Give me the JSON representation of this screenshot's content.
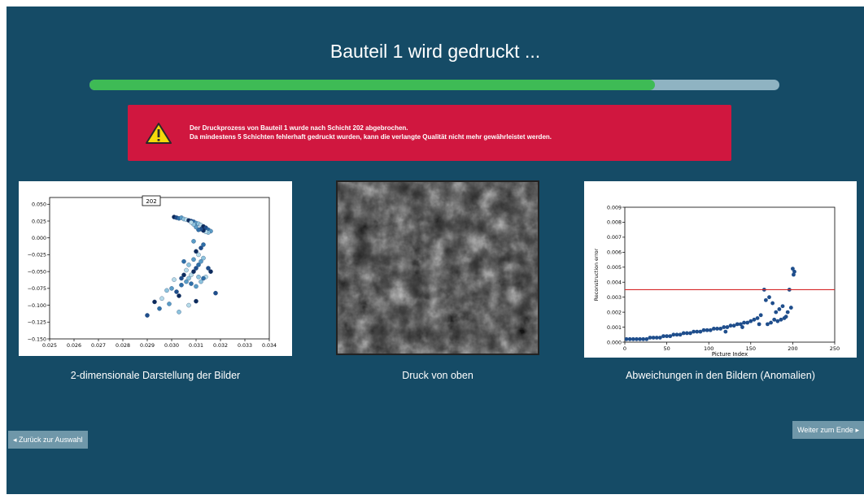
{
  "header": {
    "title": "Bauteil 1 wird gedruckt ..."
  },
  "progress": {
    "value": 0.82,
    "fill_color": "#3ebb55",
    "track_color": "#8fb3c2"
  },
  "alert": {
    "icon": "warning-icon",
    "line1": "Der Druckprozess von Bauteil 1 wurde nach Schicht 202 abgebrochen.",
    "line2": "Da mindestens 5 Schichten fehlerhaft gedruckt wurden, kann die verlangte Qualität nicht mehr gewährleistet werden.",
    "color": "#d0173f"
  },
  "panels": {
    "scatter_caption": "2-dimensionale Darstellung der Bilder",
    "photo_caption": "Druck von oben",
    "anomaly_caption": "Abweichungen in den Bildern (Anomalien)"
  },
  "nav": {
    "back_arrow": "◂",
    "back_label": "Zurück zur Auswahl",
    "next_label": "Weiter zum Ende",
    "next_arrow": "▸"
  },
  "chart_data": [
    {
      "type": "scatter",
      "annotation": "202",
      "xlim": [
        0.025,
        0.034
      ],
      "ylim": [
        -0.15,
        0.06
      ],
      "x_ticks": [
        "0.025",
        "0.026",
        "0.027",
        "0.028",
        "0.029",
        "0.030",
        "0.031",
        "0.032",
        "0.033",
        "0.034"
      ],
      "y_ticks": [
        "0.050",
        "0.025",
        "0.000",
        "−0.025",
        "−0.050",
        "−0.075",
        "−0.100",
        "−0.125",
        "−0.150"
      ],
      "points": [
        [
          0.0301,
          0.031
        ],
        [
          0.0302,
          0.03
        ],
        [
          0.0303,
          0.029
        ],
        [
          0.0304,
          0.03
        ],
        [
          0.0305,
          0.028
        ],
        [
          0.0306,
          0.027
        ],
        [
          0.0307,
          0.026
        ],
        [
          0.0308,
          0.025
        ],
        [
          0.0309,
          0.024
        ],
        [
          0.031,
          0.022
        ],
        [
          0.0311,
          0.021
        ],
        [
          0.0312,
          0.019
        ],
        [
          0.0313,
          0.017
        ],
        [
          0.0314,
          0.015
        ],
        [
          0.0315,
          0.012
        ],
        [
          0.0316,
          0.01
        ],
        [
          0.0315,
          0.008
        ],
        [
          0.0314,
          0.009
        ],
        [
          0.0313,
          0.011
        ],
        [
          0.0312,
          0.013
        ],
        [
          0.0311,
          0.012
        ],
        [
          0.031,
          0.016
        ],
        [
          0.0309,
          0.02
        ],
        [
          0.0308,
          0.023
        ],
        [
          0.0303,
          -0.086
        ],
        [
          0.0302,
          -0.08
        ],
        [
          0.0304,
          -0.07
        ],
        [
          0.0306,
          -0.065
        ],
        [
          0.0307,
          -0.06
        ],
        [
          0.0308,
          -0.055
        ],
        [
          0.0309,
          -0.05
        ],
        [
          0.031,
          -0.045
        ],
        [
          0.0311,
          -0.04
        ],
        [
          0.0312,
          -0.035
        ],
        [
          0.0313,
          -0.03
        ],
        [
          0.0311,
          -0.025
        ],
        [
          0.031,
          -0.02
        ],
        [
          0.0312,
          -0.015
        ],
        [
          0.0313,
          -0.01
        ],
        [
          0.0309,
          -0.032
        ],
        [
          0.0307,
          -0.04
        ],
        [
          0.0306,
          -0.048
        ],
        [
          0.0305,
          -0.055
        ],
        [
          0.0304,
          -0.06
        ],
        [
          0.0308,
          -0.068
        ],
        [
          0.031,
          -0.072
        ],
        [
          0.0312,
          -0.065
        ],
        [
          0.0314,
          -0.058
        ],
        [
          0.0316,
          -0.05
        ],
        [
          0.0315,
          -0.045
        ],
        [
          0.0313,
          -0.06
        ],
        [
          0.03,
          -0.075
        ],
        [
          0.0298,
          -0.078
        ],
        [
          0.0296,
          -0.09
        ],
        [
          0.0293,
          -0.095
        ],
        [
          0.029,
          -0.115
        ],
        [
          0.0295,
          -0.105
        ],
        [
          0.0299,
          -0.098
        ],
        [
          0.0303,
          -0.11
        ],
        [
          0.0307,
          -0.1
        ],
        [
          0.031,
          -0.094
        ],
        [
          0.0318,
          -0.082
        ],
        [
          0.0305,
          -0.035
        ],
        [
          0.0309,
          -0.005
        ],
        [
          0.0311,
          -0.058
        ],
        [
          0.0301,
          -0.062
        ]
      ]
    },
    {
      "type": "scatter",
      "xlabel": "Picture Index",
      "ylabel": "Reconstruction error",
      "xlim": [
        0,
        250
      ],
      "ylim": [
        0,
        0.009
      ],
      "x_ticks": [
        "0",
        "50",
        "100",
        "150",
        "200",
        "250"
      ],
      "y_ticks": [
        "0.000",
        "0.001",
        "0.002",
        "0.003",
        "0.004",
        "0.005",
        "0.006",
        "0.007",
        "0.008",
        "0.009"
      ],
      "threshold": 0.0035,
      "threshold_color": "#d62728",
      "point_color": "#1f4e8c",
      "points": [
        [
          2,
          0.0002
        ],
        [
          6,
          0.0002
        ],
        [
          10,
          0.0002
        ],
        [
          14,
          0.0002
        ],
        [
          18,
          0.0002
        ],
        [
          22,
          0.0002
        ],
        [
          26,
          0.0002
        ],
        [
          30,
          0.0003
        ],
        [
          34,
          0.0003
        ],
        [
          38,
          0.0003
        ],
        [
          42,
          0.0003
        ],
        [
          46,
          0.0004
        ],
        [
          50,
          0.0004
        ],
        [
          54,
          0.0004
        ],
        [
          58,
          0.0005
        ],
        [
          62,
          0.0005
        ],
        [
          66,
          0.0005
        ],
        [
          70,
          0.0006
        ],
        [
          74,
          0.0006
        ],
        [
          78,
          0.0006
        ],
        [
          82,
          0.0007
        ],
        [
          86,
          0.0007
        ],
        [
          90,
          0.0007
        ],
        [
          94,
          0.0008
        ],
        [
          98,
          0.0008
        ],
        [
          102,
          0.0008
        ],
        [
          106,
          0.0009
        ],
        [
          110,
          0.0009
        ],
        [
          114,
          0.0009
        ],
        [
          118,
          0.001
        ],
        [
          122,
          0.001
        ],
        [
          126,
          0.0011
        ],
        [
          130,
          0.0011
        ],
        [
          134,
          0.0012
        ],
        [
          138,
          0.0012
        ],
        [
          142,
          0.0013
        ],
        [
          146,
          0.0013
        ],
        [
          150,
          0.0014
        ],
        [
          154,
          0.0015
        ],
        [
          158,
          0.0016
        ],
        [
          162,
          0.0018
        ],
        [
          166,
          0.0035
        ],
        [
          168,
          0.0028
        ],
        [
          170,
          0.0012
        ],
        [
          174,
          0.0013
        ],
        [
          176,
          0.0026
        ],
        [
          178,
          0.0015
        ],
        [
          182,
          0.0014
        ],
        [
          184,
          0.0022
        ],
        [
          186,
          0.0015
        ],
        [
          188,
          0.0024
        ],
        [
          190,
          0.0016
        ],
        [
          192,
          0.0017
        ],
        [
          194,
          0.002
        ],
        [
          196,
          0.0035
        ],
        [
          198,
          0.0023
        ],
        [
          200,
          0.0049
        ],
        [
          201,
          0.0045
        ],
        [
          202,
          0.0047
        ],
        [
          120,
          0.0007
        ],
        [
          140,
          0.001
        ],
        [
          160,
          0.0012
        ],
        [
          172,
          0.003
        ],
        [
          180,
          0.002
        ]
      ]
    }
  ]
}
